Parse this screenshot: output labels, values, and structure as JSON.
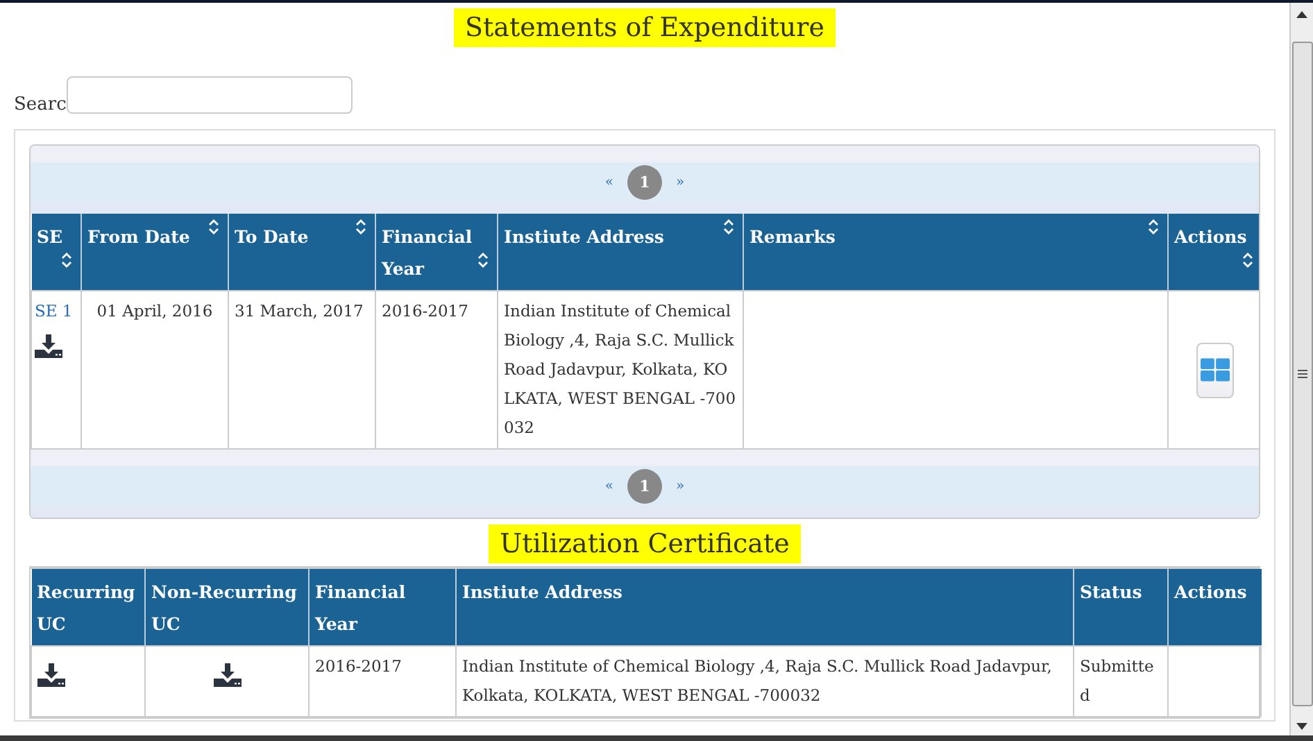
{
  "statements": {
    "title": "Statements of Expenditure",
    "search": {
      "label": "Searc"
    },
    "pager_top": {
      "prev": "«",
      "next": "»",
      "pages": [
        {
          "label": "1",
          "selected": true
        }
      ]
    },
    "columns": [
      {
        "label": "SE",
        "sortable": true
      },
      {
        "label": "From Date",
        "sortable": true
      },
      {
        "label": "To Date",
        "sortable": true
      },
      {
        "label": "Financial Year",
        "sortable": true
      },
      {
        "label": "Instiute Address",
        "sortable": true
      },
      {
        "label": "Remarks",
        "sortable": true
      },
      {
        "label": "Actions",
        "sortable": true
      }
    ],
    "rows": [
      {
        "cells": [
          {
            "kind": "link_download",
            "text": "SE 1"
          },
          {
            "kind": "text",
            "text": "01 April, 2016"
          },
          {
            "kind": "text",
            "text": "31 March, 2017"
          },
          {
            "kind": "text",
            "text": "2016-2017"
          },
          {
            "kind": "text",
            "text": "Indian Institute of Chemical Biology ,4, Raja S.C. Mullick Road Jadavpur, Kolkata, KOLKATA, WEST BENGAL -700032"
          },
          {
            "kind": "empty"
          },
          {
            "kind": "grid_button"
          }
        ]
      }
    ],
    "pager_bottom": {
      "prev": "«",
      "next": "»",
      "pages": [
        {
          "label": "1",
          "selected": true
        }
      ]
    }
  },
  "certificates": {
    "title": "Utilization Certificate",
    "columns": [
      {
        "label": "Recurring UC",
        "sortable": false
      },
      {
        "label": "Non-Recurring UC",
        "sortable": false
      },
      {
        "label": "Financial Year",
        "sortable": false
      },
      {
        "label": "Instiute Address",
        "sortable": false
      },
      {
        "label": "Status",
        "sortable": false
      },
      {
        "label": "Actions",
        "sortable": false
      }
    ],
    "rows": [
      {
        "cells": [
          {
            "kind": "download"
          },
          {
            "kind": "download"
          },
          {
            "kind": "text",
            "text": "2016-2017"
          },
          {
            "kind": "text",
            "text": "Indian Institute of Chemical Biology ,4, Raja S.C. Mullick Road Jadavpur, Kolkata, KOLKATA, WEST BENGAL -700032"
          },
          {
            "kind": "text",
            "text": "Submitted"
          },
          {
            "kind": "empty"
          }
        ]
      }
    ]
  }
}
